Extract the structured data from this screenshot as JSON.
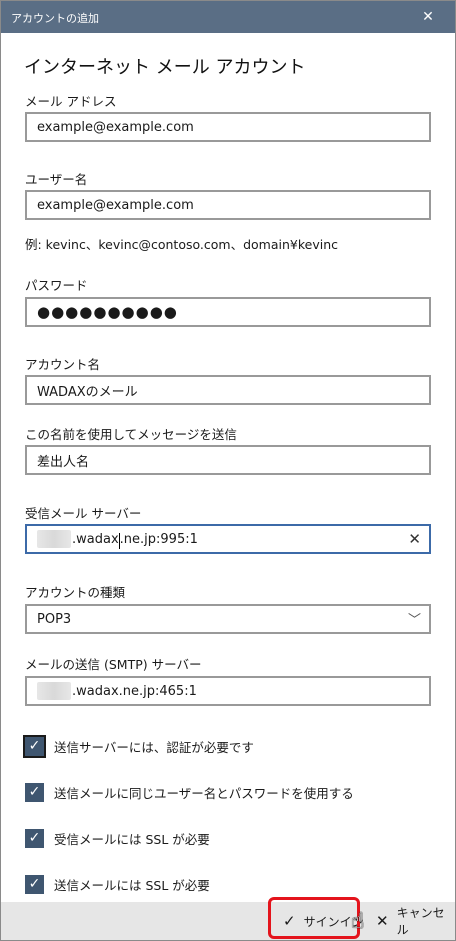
{
  "window": {
    "title": "アカウントの追加",
    "close_glyph": "✕"
  },
  "heading": "インターネット メール アカウント",
  "email": {
    "label": "メール アドレス",
    "value": "example@example.com"
  },
  "username": {
    "label": "ユーザー名",
    "value": "example@example.com",
    "example": "例: kevinc、kevinc@contoso.com、domain¥kevinc"
  },
  "password": {
    "label": "パスワード",
    "value": "●●●●●●●●●●"
  },
  "account_name": {
    "label": "アカウント名",
    "value": "WADAXのメール"
  },
  "send_name": {
    "label": "この名前を使用してメッセージを送信",
    "value": "差出人名"
  },
  "incoming_server": {
    "label": "受信メール サーバー",
    "value_before_caret": ".wadax",
    "value_after_caret": ".ne.jp:995:1",
    "clear_glyph": "✕"
  },
  "account_type": {
    "label": "アカウントの種類",
    "value": "POP3",
    "chevron_glyph": "﹀"
  },
  "outgoing_server": {
    "label": "メールの送信 (SMTP) サーバー",
    "value": ".wadax.ne.jp:465:1"
  },
  "checkboxes": [
    {
      "label": "送信サーバーには、認証が必要です",
      "checked": true
    },
    {
      "label": "送信メールに同じユーザー名とパスワードを使用する",
      "checked": true
    },
    {
      "label": "受信メールには SSL が必要",
      "checked": true
    },
    {
      "label": "送信メールには SSL が必要",
      "checked": true
    }
  ],
  "check_glyph": "✓",
  "footer": {
    "signin_label": "サインイン",
    "signin_glyph": "✓",
    "cancel_label": "キャンセル",
    "cancel_glyph": "✕"
  },
  "colors": {
    "titlebar": "#5a6e85",
    "checkbox": "#3f5670",
    "highlight": "#e4141c"
  },
  "cursor_glyph": "☝"
}
